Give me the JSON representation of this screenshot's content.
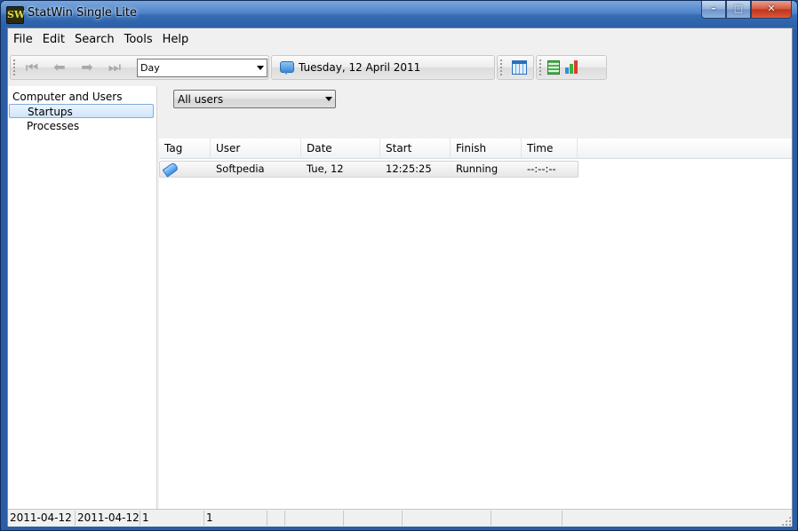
{
  "window": {
    "title": "StatWin Single Lite",
    "app_icon_text": "SW",
    "controls": {
      "minimize": "–",
      "maximize": "□",
      "close": "✕"
    }
  },
  "menu": [
    "File",
    "Edit",
    "Search",
    "Tools",
    "Help"
  ],
  "toolbar": {
    "nav": {
      "first": "⏮",
      "prev": "⬅",
      "next": "➡",
      "last": "⏭"
    },
    "period": "Day",
    "date": "Tuesday, 12 April 2011"
  },
  "tree": {
    "root": "Computer and Users",
    "items": [
      {
        "label": "Startups",
        "selected": true
      },
      {
        "label": "Processes",
        "selected": false
      }
    ]
  },
  "user_filter": {
    "value": "All users"
  },
  "grid": {
    "columns": [
      "Tag",
      "User",
      "Date",
      "Start",
      "Finish",
      "Time"
    ],
    "rows": [
      {
        "tag_icon": "tag-icon",
        "user": "Softpedia",
        "date": "Tue, 12",
        "start": "12:25:25",
        "finish": "Running",
        "time": "--:--:--"
      }
    ]
  },
  "status": {
    "from": "2011-04-12",
    "to": "2011-04-12",
    "count_a": "1",
    "count_b": "1"
  },
  "colors": {
    "title_blue": "#4f85c9",
    "selection": "#cfe5fa",
    "close_red": "#c0321c"
  }
}
